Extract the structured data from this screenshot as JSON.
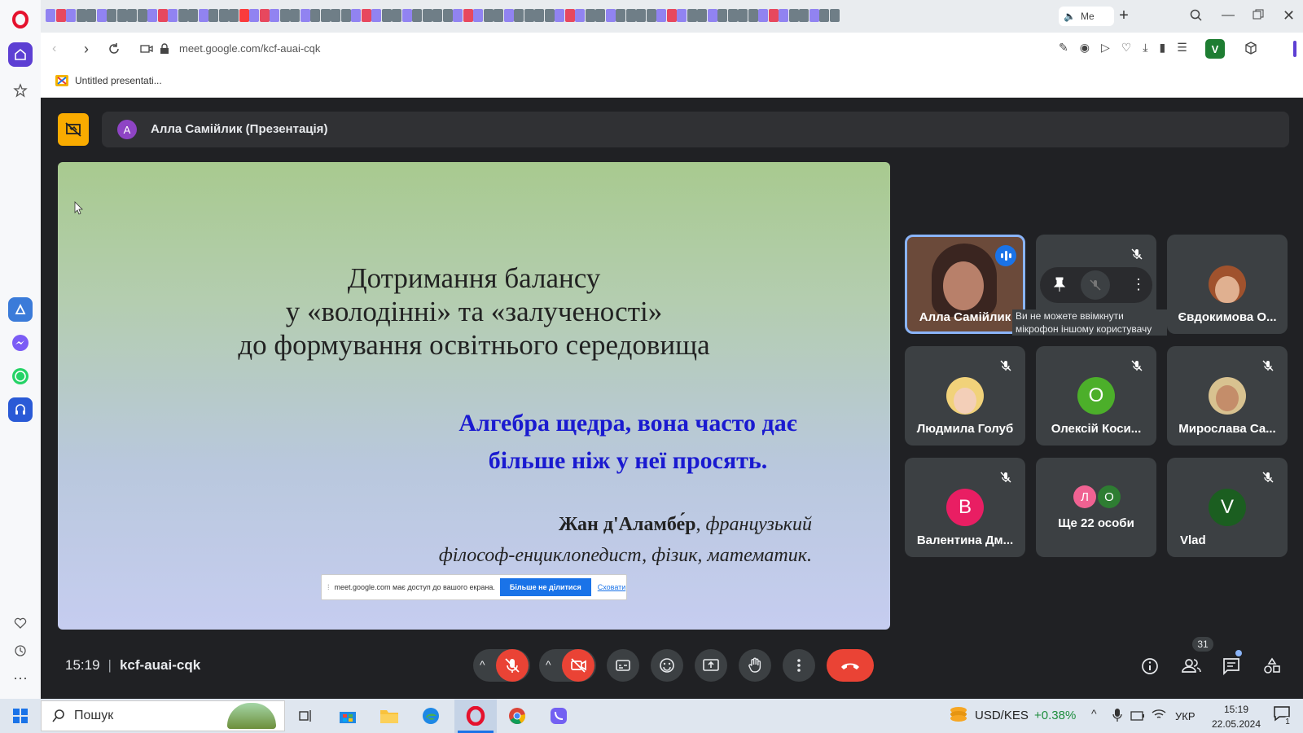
{
  "browser": {
    "url": "meet.google.com/kcf-auai-cqk",
    "bookmark": "Untitled presentati...",
    "tab_last": "Me",
    "profile_letter": "V"
  },
  "meet": {
    "presenter_initial": "А",
    "presenter_banner": "Алла Самійлик (Презентація)",
    "time": "15:19",
    "separator": "|",
    "meeting_code": "kcf-auai-cqk",
    "people_count": "31"
  },
  "slide": {
    "title_line1": "Дотримання балансу",
    "title_line2": "у «володінні» та «залученості»",
    "title_line3": "до формування освітнього середовища",
    "quote_line1": "Алгебра щедра, вона часто дає",
    "quote_line2": "більше ніж у неї просять.",
    "author_name": "Жан д'Аламбе́р",
    "author_comma": ",",
    "author_desc1": "французький",
    "author_desc2": "філософ-енциклопедист, фізик, математик."
  },
  "share_bar": {
    "handle": "⁞",
    "text": "meet.google.com має доступ до вашого екрана.",
    "stop_button": "Більше не ділитися",
    "hide_link": "Сховати"
  },
  "participants": [
    {
      "name": "Алла Самійлик"
    },
    {
      "name": "Ви не можете ввімкнути мікрофон іншому користувачу"
    },
    {
      "name": "Євдокимова О..."
    },
    {
      "name": "Людмила Голуб"
    },
    {
      "name": "Олексій Коси...",
      "initial": "О"
    },
    {
      "name": "Мирослава Са..."
    },
    {
      "name": "Валентина Дм...",
      "initial": "В"
    },
    {
      "name": "Ще 22 особи",
      "initial_a": "Л",
      "initial_b": "О"
    },
    {
      "name": "Vlad",
      "initial": "V"
    }
  ],
  "taskbar": {
    "search": "Пошук",
    "ticker": "USD/KES",
    "ticker_change": "+0.38%",
    "language": "УКР",
    "time": "15:19",
    "date": "22.05.2024",
    "notif_count": "1"
  },
  "colors": {
    "accent_blue": "#1a73e8",
    "end_call_red": "#ea4335",
    "slide_quote_blue": "#1a1ad0",
    "yellow_badge": "#f9ab00",
    "ticker_green": "#1e8e3e"
  }
}
